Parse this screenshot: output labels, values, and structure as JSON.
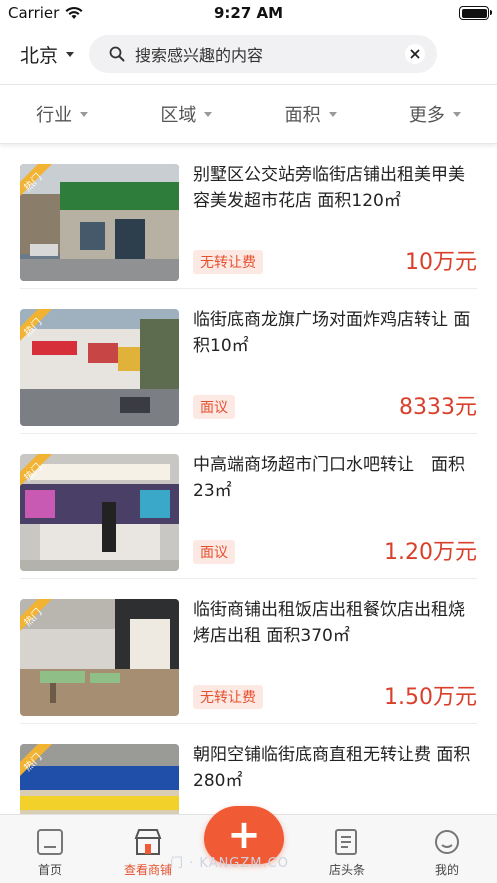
{
  "status_bar": {
    "carrier": "Carrier",
    "time": "9:27 AM"
  },
  "header": {
    "city": "北京",
    "search_placeholder": "搜索感兴趣的内容"
  },
  "filters": [
    "行业",
    "区域",
    "面积",
    "更多"
  ],
  "listings": [
    {
      "badge": "热门",
      "title": "别墅区公交站旁临街店铺出租美甲美容美发超市花店 面积120㎡",
      "tag": "无转让费",
      "price": "10万元"
    },
    {
      "badge": "热门",
      "title": "临街底商龙旗广场对面炸鸡店转让 面积10㎡",
      "tag": "面议",
      "price": "8333元"
    },
    {
      "badge": "热门",
      "title": "中高端商场超市门口水吧转让　面积23㎡",
      "tag": "面议",
      "price": "1.20万元"
    },
    {
      "badge": "热门",
      "title": "临街商铺出租饭店出租餐饮店出租烧烤店出租 面积370㎡",
      "tag": "无转让费",
      "price": "1.50万元"
    },
    {
      "badge": "热门",
      "title": "朝阳空铺临街底商直租无转让费 面积280㎡",
      "tag": "",
      "price": ""
    }
  ],
  "tabbar": {
    "home": "首页",
    "browse": "查看商铺",
    "publish_icon": "plus-icon",
    "news": "店头条",
    "profile": "我的"
  },
  "watermark": "门 · KANGZM.CO",
  "colors": {
    "accent": "#f05a35",
    "price": "#d9402b",
    "tag_bg": "#fde9e4"
  }
}
